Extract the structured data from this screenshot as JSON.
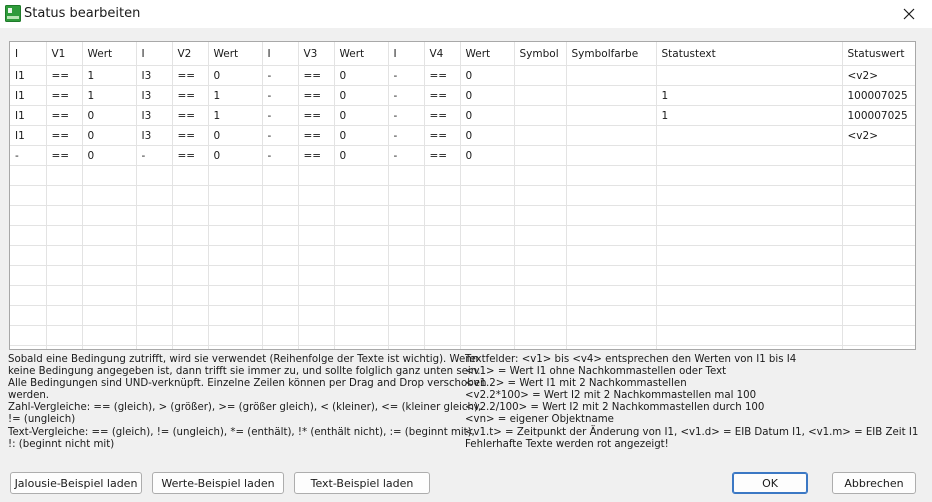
{
  "window": {
    "title": "Status bearbeiten",
    "close_icon": "close-icon",
    "app_icon": "sheet-icon"
  },
  "table": {
    "headers": [
      "I",
      "V1",
      "Wert",
      "I",
      "V2",
      "Wert",
      "I",
      "V3",
      "Wert",
      "I",
      "V4",
      "Wert",
      "Symbol",
      "Symbolfarbe",
      "Statustext",
      "Statuswert"
    ],
    "rows": [
      [
        "I1",
        "==",
        "1",
        "I3",
        "==",
        "0",
        "-",
        "==",
        "0",
        "-",
        "==",
        "0",
        "",
        "",
        "",
        "<v2>"
      ],
      [
        "I1",
        "==",
        "1",
        "I3",
        "==",
        "1",
        "-",
        "==",
        "0",
        "-",
        "==",
        "0",
        "",
        "",
        "1",
        "100007025"
      ],
      [
        "I1",
        "==",
        "0",
        "I3",
        "==",
        "1",
        "-",
        "==",
        "0",
        "-",
        "==",
        "0",
        "",
        "",
        "1",
        "100007025"
      ],
      [
        "I1",
        "==",
        "0",
        "I3",
        "==",
        "0",
        "-",
        "==",
        "0",
        "-",
        "==",
        "0",
        "",
        "",
        "",
        "<v2>"
      ],
      [
        "-",
        "==",
        "0",
        "-",
        "==",
        "0",
        "-",
        "==",
        "0",
        "-",
        "==",
        "0",
        "",
        "",
        "",
        ""
      ]
    ],
    "empty_rows": 10
  },
  "help_left": [
    "Sobald eine Bedingung zutrifft, wird sie verwendet (Reihenfolge der Texte ist wichtig). Wenn",
    "keine Bedingung angegeben ist, dann trifft sie immer zu, und sollte folglich ganz unten sein.",
    "Alle Bedingungen sind UND-verknüpft. Einzelne Zeilen können per Drag and Drop verschoben",
    "werden.",
    "Zahl-Vergleiche: == (gleich), > (größer), >= (größer gleich), < (kleiner), <= (kleiner gleich),",
    "!= (ungleich)",
    "Text-Vergleiche: == (gleich), != (ungleich), *= (enthält), !* (enthält nicht), := (beginnt mit),",
    "!: (beginnt nicht mit)"
  ],
  "help_right": [
    "Textfelder: <v1> bis <v4> entsprechen den Werten von I1 bis I4",
    "<v1> = Wert I1 ohne Nachkommastellen oder Text",
    "<v1.2> = Wert I1 mit 2 Nachkommastellen",
    "<v2.2*100> = Wert I2 mit 2 Nachkommastellen mal 100",
    "<v2.2/100> = Wert I2 mit 2 Nachkommastellen durch 100",
    "<vn> = eigener Objektname",
    "<v1.t> = Zeitpunkt der Änderung von I1, <v1.d> = EIB Datum I1, <v1.m> = EIB Zeit I1",
    "Fehlerhafte Texte werden rot angezeigt!"
  ],
  "buttons": {
    "jalousie": "Jalousie-Beispiel laden",
    "werte": "Werte-Beispiel laden",
    "text": "Text-Beispiel laden",
    "ok": "OK",
    "cancel": "Abbrechen"
  }
}
